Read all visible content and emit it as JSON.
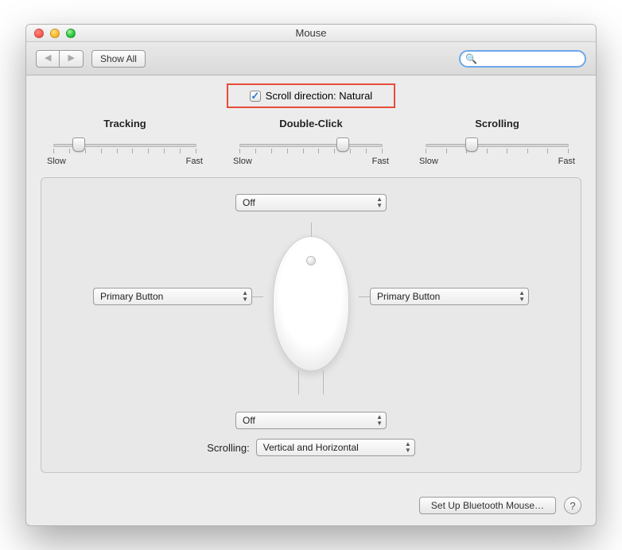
{
  "window": {
    "title": "Mouse"
  },
  "toolbar": {
    "show_all": "Show All"
  },
  "highlight": {
    "checked": true,
    "label": "Scroll direction: Natural"
  },
  "sliders": {
    "tracking": {
      "label": "Tracking",
      "low": "Slow",
      "high": "Fast",
      "pos": 18
    },
    "dblclick": {
      "label": "Double-Click",
      "low": "Slow",
      "high": "Fast",
      "pos": 72
    },
    "scrolling": {
      "label": "Scrolling",
      "low": "Slow",
      "high": "Fast",
      "pos": 32
    }
  },
  "panel": {
    "top_button": "Off",
    "left_button": "Primary Button",
    "right_button": "Primary Button",
    "squeeze": "Off",
    "scroll_label": "Scrolling:",
    "scroll_value": "Vertical and Horizontal"
  },
  "footer": {
    "bluetooth": "Set Up Bluetooth Mouse…"
  }
}
